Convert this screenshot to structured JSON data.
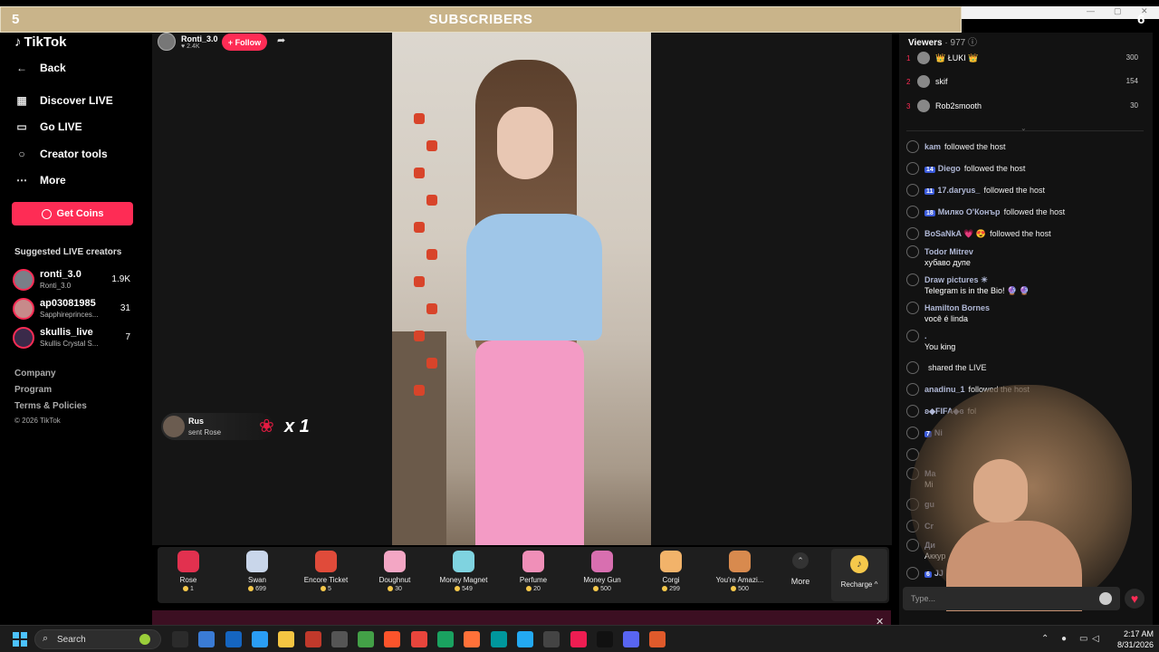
{
  "overlay": {
    "title": "SUBSCRIBERS",
    "left_number": "5",
    "right_number": "6"
  },
  "sidebar": {
    "logo": "TikTok",
    "nav": [
      {
        "label": "Back",
        "icon": "arrow-left-icon"
      },
      {
        "label": "Discover LIVE",
        "icon": "calendar-icon"
      },
      {
        "label": "Go LIVE",
        "icon": "video-camera-icon"
      },
      {
        "label": "Creator tools",
        "icon": "lightbulb-icon"
      },
      {
        "label": "More",
        "icon": "ellipsis-icon"
      }
    ],
    "get_coins": "Get Coins",
    "suggested_title": "Suggested LIVE creators",
    "creators": [
      {
        "name": "ronti_3.0",
        "sub": "Ronti_3.0",
        "count": "1.9K"
      },
      {
        "name": "ap03081985",
        "sub": "Sapphireprinces...",
        "count": "31"
      },
      {
        "name": "skullis_live",
        "sub": "Skullis Crystal S...",
        "count": "7"
      }
    ],
    "footer_links": [
      "Company",
      "Program",
      "Terms & Policies"
    ],
    "copyright": "© 2026 TikTok"
  },
  "stream": {
    "host_name": "Ronti_3.0",
    "host_likes": "2.4K",
    "follow_label": "+ Follow"
  },
  "gift_notice": {
    "user": "Rus",
    "action": "sent Rose",
    "count": "x 1"
  },
  "gifts": [
    {
      "name": "Rose",
      "price": "1",
      "color": "#e2314f"
    },
    {
      "name": "Swan",
      "price": "699",
      "color": "#c9d6ea"
    },
    {
      "name": "Encore Ticket",
      "price": "5",
      "color": "#e04b3a"
    },
    {
      "name": "Doughnut",
      "price": "30",
      "color": "#f3a6c4"
    },
    {
      "name": "Money Magnet",
      "price": "549",
      "color": "#7fd3e0"
    },
    {
      "name": "Perfume",
      "price": "20",
      "color": "#f08fb8"
    },
    {
      "name": "Money Gun",
      "price": "500",
      "color": "#d86fb0"
    },
    {
      "name": "Corgi",
      "price": "299",
      "color": "#f2b36a"
    },
    {
      "name": "You're Amazi...",
      "price": "500",
      "color": "#d88a4e"
    }
  ],
  "more_label": "More",
  "recharge_label": "Recharge ^",
  "chat": {
    "viewers_label": "Viewers",
    "viewers_count": "· 977",
    "top_viewers": [
      {
        "rank": "1",
        "name": "👑 ŁUKI 👑",
        "score": "300"
      },
      {
        "rank": "2",
        "name": "skif",
        "score": "154"
      },
      {
        "rank": "3",
        "name": "Rob2smooth",
        "score": "30"
      }
    ],
    "messages": [
      {
        "user": "kam",
        "badge": "",
        "action": "followed the host",
        "text": ""
      },
      {
        "user": "Diego",
        "badge": "14",
        "action": "followed the host",
        "text": ""
      },
      {
        "user": "17.daryus_",
        "badge": "11",
        "action": "followed the host",
        "text": ""
      },
      {
        "user": "Милко О'Конър",
        "badge": "18",
        "action": "followed the host",
        "text": ""
      },
      {
        "user": "BoSaNkA 💗 😍",
        "badge": "",
        "action": "followed the host",
        "text": ""
      },
      {
        "user": "Todor Mitrev",
        "badge": "",
        "action": "",
        "text": "хубаво дупе"
      },
      {
        "user": "Draw pictures ☀",
        "badge": "",
        "action": "",
        "text": "Telegram is in the Bio! 🔮 🔮"
      },
      {
        "user": "Hamilton Bornes",
        "badge": "",
        "action": "",
        "text": "você é linda"
      },
      {
        "user": ".",
        "badge": "",
        "action": "",
        "text": "You king"
      },
      {
        "user": "",
        "badge": "",
        "action": "shared the LIVE",
        "text": ""
      },
      {
        "user": "anadinu_1",
        "badge": "",
        "action": "followed the host",
        "text": ""
      },
      {
        "user": "ʚ◆FIFA◆ɞ",
        "badge": "",
        "action": "fol",
        "text": ""
      },
      {
        "user": "Ni",
        "badge": "7",
        "action": "",
        "text": ""
      },
      {
        "user": "",
        "badge": "",
        "action": "",
        "text": ""
      },
      {
        "user": "Ma",
        "badge": "",
        "action": "",
        "text": "Mi"
      },
      {
        "user": "gu",
        "badge": "",
        "action": "",
        "text": ""
      },
      {
        "user": "Cr",
        "badge": "",
        "action": "",
        "text": ""
      },
      {
        "user": "Ди",
        "badge": "",
        "action": "",
        "text": "Аккур"
      },
      {
        "user": "JJ",
        "badge": "6",
        "action": "",
        "text": ""
      }
    ],
    "type_placeholder": "Type..."
  },
  "taskbar": {
    "search_label": "Search",
    "apps": [
      "rdp-icon",
      "network-icon",
      "outlook-icon",
      "remote-icon",
      "folder-icon",
      "news-icon",
      "clock-icon",
      "map-icon",
      "brave-icon",
      "chrome-icon",
      "edge-icon",
      "firefox-icon",
      "arduino-icon",
      "vscode-icon",
      "obs-icon",
      "tiktok-icon",
      "tiktok-live-icon",
      "discord-icon",
      "sun-icon"
    ],
    "time": "2:17 AM",
    "date": "8/31/2026"
  }
}
